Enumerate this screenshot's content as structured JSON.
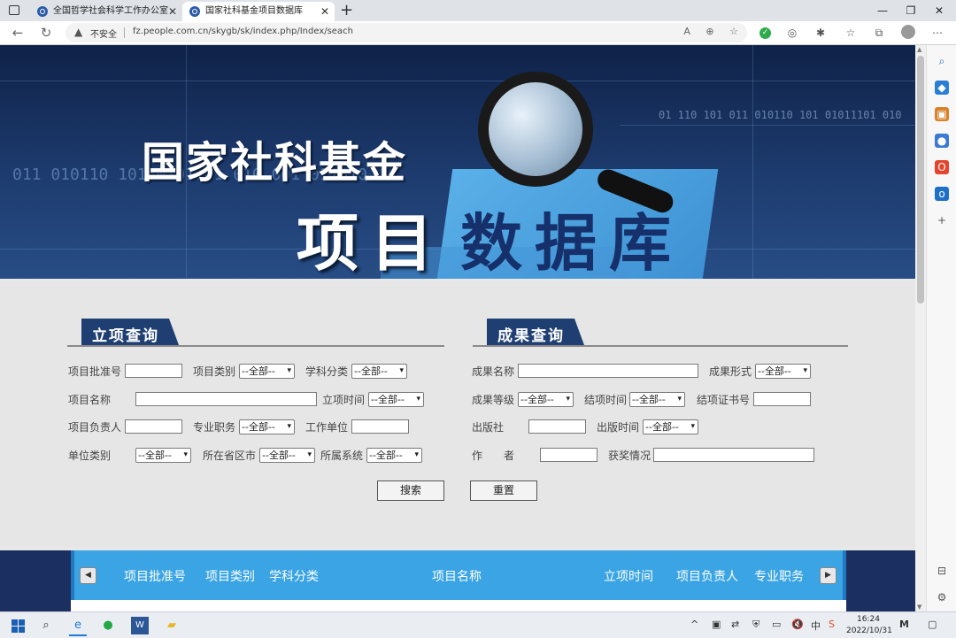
{
  "browser": {
    "tabs": [
      {
        "label": "全国哲学社会科学工作办公室"
      },
      {
        "label": "国家社科基金项目数据库"
      }
    ],
    "new_tab_label": "+",
    "window_controls": {
      "minimize": "—",
      "restore": "❐",
      "close": "✕"
    },
    "security_label": "不安全",
    "url": "fz.people.com.cn/skygb/sk/index.php/Index/seach"
  },
  "banner": {
    "title_line1": "国家社科基金",
    "title_line2a": "项目",
    "title_line2b": "数据库",
    "binary_left": "011  010110  101  0101101  010  001  011010",
    "binary_right": "01  110  101  011  010110  101  01011101  010"
  },
  "project_query": {
    "section_title": "立项查询",
    "fields": {
      "approval_no": {
        "label": "项目批准号",
        "value": ""
      },
      "project_type": {
        "label": "项目类别",
        "selected": "--全部--"
      },
      "discipline": {
        "label": "学科分类",
        "selected": "--全部--"
      },
      "project_name": {
        "label": "项目名称",
        "value": ""
      },
      "approval_time": {
        "label": "立项时间",
        "selected": "--全部--"
      },
      "leader": {
        "label": "项目负责人",
        "value": ""
      },
      "title_rank": {
        "label": "专业职务",
        "selected": "--全部--"
      },
      "work_unit": {
        "label": "工作单位",
        "value": ""
      },
      "unit_type": {
        "label": "单位类别",
        "selected": "--全部--"
      },
      "province": {
        "label": "所在省区市",
        "selected": "--全部--"
      },
      "system": {
        "label": "所属系统",
        "selected": "--全部--"
      }
    }
  },
  "result_query": {
    "section_title": "成果查询",
    "fields": {
      "result_name": {
        "label": "成果名称",
        "value": ""
      },
      "result_form": {
        "label": "成果形式",
        "selected": "--全部--"
      },
      "result_grade": {
        "label": "成果等级",
        "selected": "--全部--"
      },
      "conclusion_time": {
        "label": "结项时间",
        "selected": "--全部--"
      },
      "certificate_no": {
        "label": "结项证书号",
        "value": ""
      },
      "publisher": {
        "label": "出版社",
        "value": ""
      },
      "publish_time": {
        "label": "出版时间",
        "selected": "--全部--"
      },
      "author": {
        "label": "作　　者",
        "value": ""
      },
      "awards": {
        "label": "获奖情况",
        "value": ""
      }
    }
  },
  "buttons": {
    "search": "搜索",
    "reset": "重置"
  },
  "results_table": {
    "prev_label": "◀",
    "next_label": "▶",
    "columns": [
      "项目批准号",
      "项目类别",
      "学科分类",
      "项目名称",
      "立项时间",
      "项目负责人",
      "专业职务"
    ]
  },
  "taskbar": {
    "time": "16:24",
    "date": "2022/10/31"
  }
}
